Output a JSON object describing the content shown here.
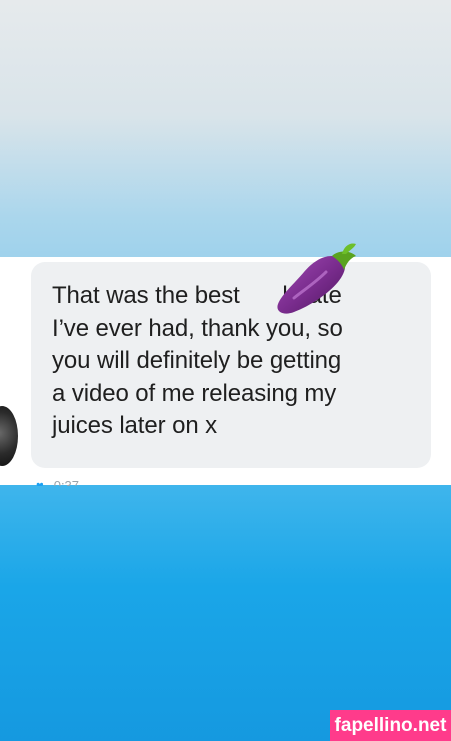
{
  "message": {
    "lines": [
      "That was the best ",
      "I’ve ever had, thank you, so",
      "you will definitely be getting",
      "a video of me releasing my",
      "juices later on x"
    ],
    "line1_tail": "k rate",
    "emoji": "eggplant-icon"
  },
  "meta": {
    "heart": "heart-icon",
    "time": "0:37"
  },
  "watermark": "fapellino.net",
  "colors": {
    "bubble": "#eef0f2",
    "text": "#1f1f1f",
    "accent_blue": "#1da1f2",
    "watermark_bg": "#ff3b8b"
  }
}
